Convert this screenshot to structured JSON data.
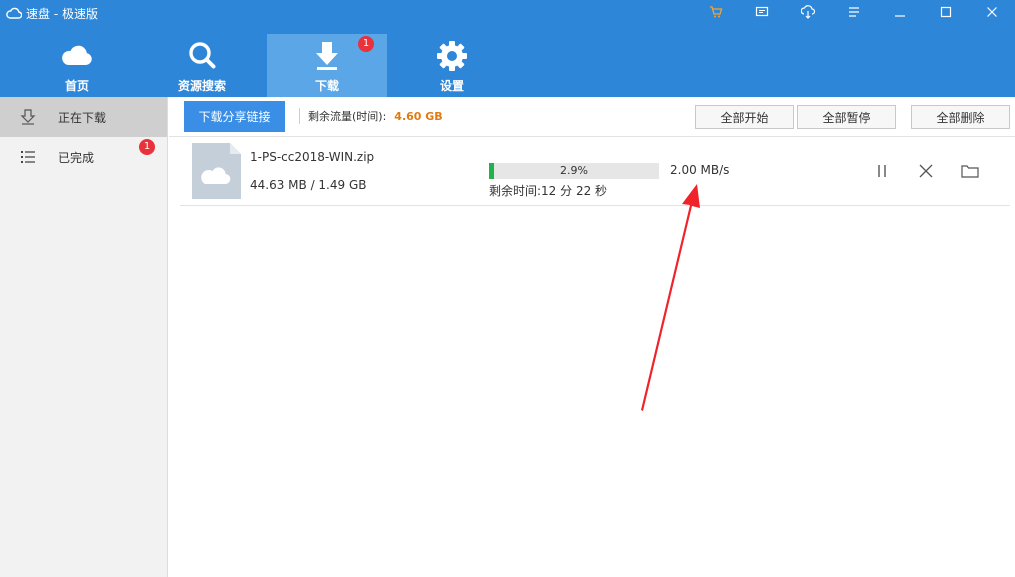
{
  "app": {
    "title": "速盘 - 极速版"
  },
  "window_controls": [
    "cart-icon",
    "message-icon",
    "transfer-icon",
    "menu-icon",
    "minimize-icon",
    "maximize-icon",
    "close-icon"
  ],
  "nav": {
    "tabs": [
      {
        "label": "首页",
        "icon": "cloud-icon"
      },
      {
        "label": "资源搜索",
        "icon": "search-icon"
      },
      {
        "label": "下载",
        "icon": "download-icon",
        "badge": "1",
        "active": true
      },
      {
        "label": "设置",
        "icon": "gear-icon"
      }
    ]
  },
  "sidebar": {
    "items": [
      {
        "label": "正在下载",
        "icon": "downloading-icon",
        "active": true
      },
      {
        "label": "已完成",
        "icon": "list-icon",
        "badge": "1"
      }
    ]
  },
  "toolbar": {
    "share_label": "下载分享链接",
    "traffic_label": "剩余流量(时间):",
    "traffic_value": "4.60 GB",
    "start_all": "全部开始",
    "pause_all": "全部暂停",
    "delete_all": "全部删除"
  },
  "download": {
    "file_name": "1-PS-cc2018-WIN.zip",
    "size_text": "44.63 MB / 1.49 GB",
    "progress_text": "2.9%",
    "progress_fraction": 0.029,
    "remaining": "剩余时间:12 分 22 秒",
    "speed": "2.00 MB/s"
  },
  "colors": {
    "header_bg": "#2e86d8",
    "active_tab": "#5aa6e6",
    "badge": "#e8323c",
    "progress": "#22b14c",
    "traffic_value": "#e07b12",
    "annotation": "#f0222a"
  }
}
